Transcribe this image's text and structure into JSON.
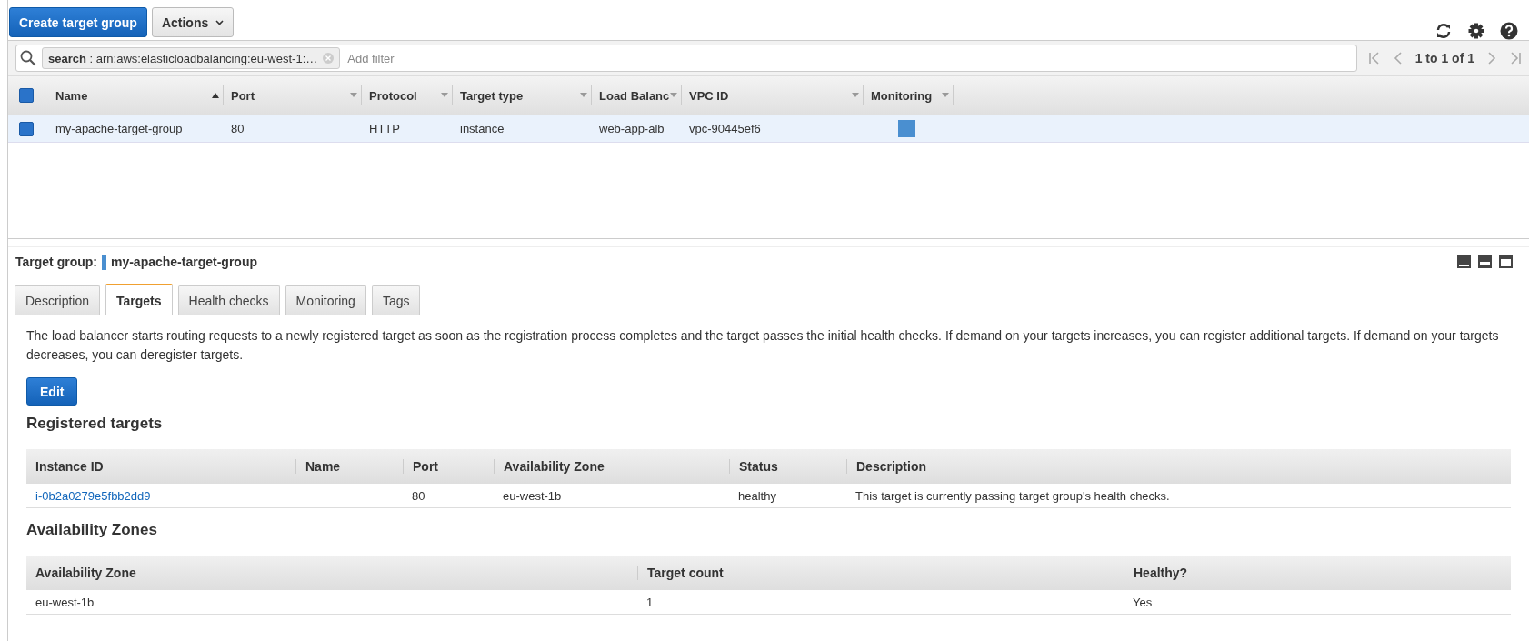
{
  "toolbar": {
    "create_button": "Create target group",
    "actions_button": "Actions"
  },
  "filter": {
    "token": "**search** : arn:aws:elasticloadbalancing:eu-west-1:…",
    "placeholder": "Add filter"
  },
  "pagination": {
    "label": "1 to 1 of 1"
  },
  "grid": {
    "select_all_checked": true,
    "columns": [
      {
        "label": "Name",
        "sorted": true
      },
      {
        "label": "Port",
        "sorted": false
      },
      {
        "label": "Protocol",
        "sorted": false
      },
      {
        "label": "Target type",
        "sorted": false
      },
      {
        "label": "Load Balanc",
        "sorted": false
      },
      {
        "label": "VPC ID",
        "sorted": false
      },
      {
        "label": "Monitoring",
        "sorted": false
      }
    ],
    "rows": [
      {
        "selected": true,
        "cells": [
          "my-apache-target-group",
          "80",
          "HTTP",
          "instance",
          "web-app-alb",
          "vpc-90445ef6"
        ],
        "monitoring": true
      }
    ]
  },
  "detail": {
    "label": "Target group:",
    "name": "my-apache-target-group",
    "tabs": [
      {
        "label": "Description",
        "selected": false
      },
      {
        "label": "Targets",
        "selected": true
      },
      {
        "label": "Health checks",
        "selected": false
      },
      {
        "label": "Monitoring",
        "selected": false
      },
      {
        "label": "Tags",
        "selected": false
      }
    ],
    "intro": "The load balancer starts routing requests to a newly registered target as soon as the registration process completes and the target passes the initial health checks. If demand on your targets increases, you can register additional targets. If demand on your targets decreases, you can deregister targets.",
    "edit_button": "Edit",
    "registered_title": "Registered targets",
    "registered_columns": [
      "Instance ID",
      "Name",
      "Port",
      "Availability Zone",
      "Status",
      "Description"
    ],
    "registered_rows": [
      [
        "i-0b2a0279e5fbb2dd9",
        "",
        "80",
        "eu-west-1b",
        "healthy",
        "This target is currently passing target group's health checks."
      ]
    ],
    "zones_title": "Availability Zones",
    "zones_columns": [
      "Availability Zone",
      "Target count",
      "Healthy?"
    ],
    "zones_rows": [
      [
        "eu-west-1b",
        "1",
        "Yes"
      ]
    ]
  }
}
